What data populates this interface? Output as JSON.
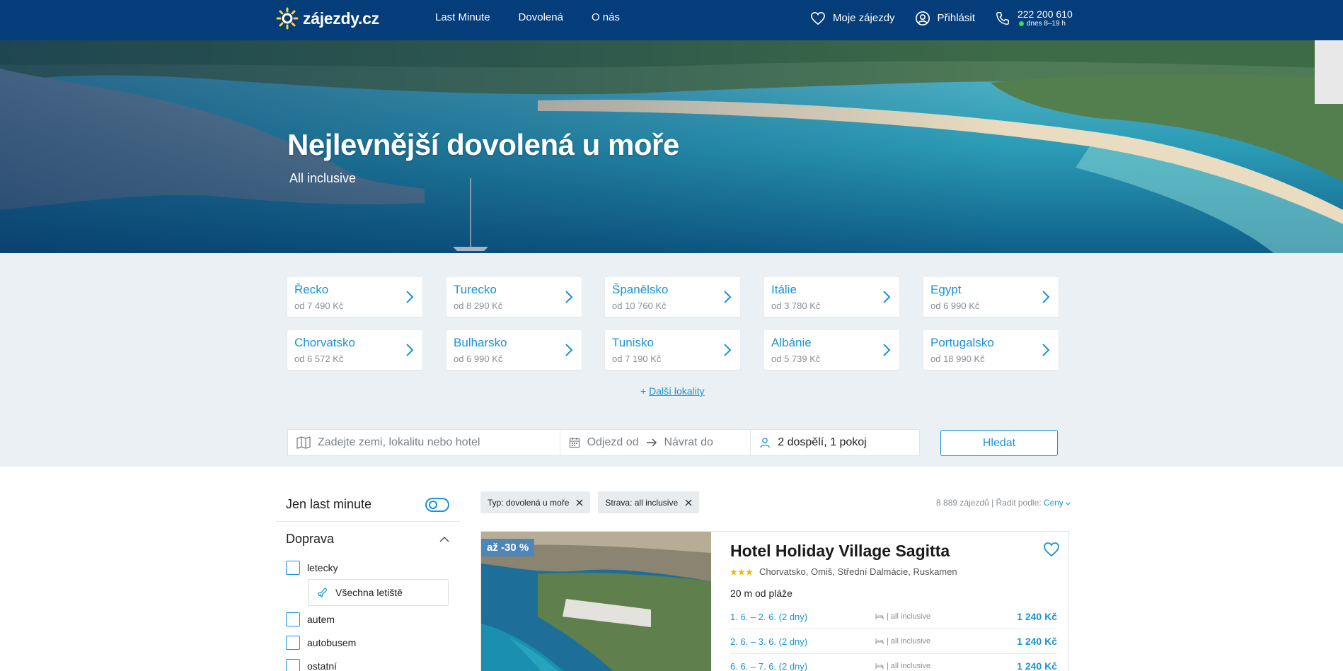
{
  "header": {
    "logo_text": "zájezdy.cz",
    "nav": [
      "Last Minute",
      "Dovolená",
      "O nás"
    ],
    "my_trips": "Moje zájezdy",
    "login": "Přihlásit",
    "phone": "222 200 610",
    "phone_hours": "dnes 8–19 h"
  },
  "hero": {
    "title": "Nejlevnější dovolená u moře",
    "subtitle": "All inclusive"
  },
  "destinations": [
    {
      "name": "Řecko",
      "price": "od 7 490 Kč"
    },
    {
      "name": "Turecko",
      "price": "od 8 290 Kč"
    },
    {
      "name": "Španělsko",
      "price": "od 10 760 Kč"
    },
    {
      "name": "Itálie",
      "price": "od 3 780 Kč"
    },
    {
      "name": "Egypt",
      "price": "od 6 990 Kč"
    },
    {
      "name": "Chorvatsko",
      "price": "od 6 572 Kč"
    },
    {
      "name": "Bulharsko",
      "price": "od 6 990 Kč"
    },
    {
      "name": "Tunisko",
      "price": "od 7 190 Kč"
    },
    {
      "name": "Albánie",
      "price": "od 5 739 Kč"
    },
    {
      "name": "Portugalsko",
      "price": "od 18 990 Kč"
    }
  ],
  "more_locations": {
    "prefix": "+ ",
    "label": "Další lokality"
  },
  "search": {
    "where_placeholder": "Zadejte zemi, lokalitu nebo hotel",
    "date_from": "Odjezd od",
    "date_to": "Návrat do",
    "persons": "2 dospělí, 1 pokoj",
    "button": "Hledat"
  },
  "filters": {
    "last_minute": "Jen last minute",
    "last_minute_on": false,
    "transport_title": "Doprava",
    "transport": [
      "letecky",
      "autem",
      "autobusem",
      "ostatní"
    ],
    "airports": "Všechna letiště"
  },
  "results": {
    "chips": [
      "Typ: dovolená u moře",
      "Strava: all inclusive"
    ],
    "count": "8 889 zájezdů",
    "sort_label": "Řadit podle:",
    "sort_value": "Ceny"
  },
  "hotel": {
    "discount": "až -30 %",
    "name": "Hotel Holiday Village Sagitta",
    "stars": 3,
    "location": "Chorvatsko, Omiš, Střední Dalmácie, Ruskamen",
    "beach": "20 m od pláže",
    "terms": [
      {
        "date": "1. 6. – 2. 6. (2 dny)",
        "board": "| all inclusive",
        "price": "1 240 Kč"
      },
      {
        "date": "2. 6. – 3. 6. (2 dny)",
        "board": "| all inclusive",
        "price": "1 240 Kč"
      },
      {
        "date": "6. 6. – 7. 6. (2 dny)",
        "board": "| all inclusive",
        "price": "1 240 Kč"
      }
    ]
  },
  "icons": {
    "logo": "sun-icon",
    "my_trips": "heart-icon",
    "login": "user-icon",
    "phone": "phone-icon",
    "dest": "chevron-right-icon",
    "where": "map-icon",
    "date": "calendar-icon",
    "persons": "person-icon",
    "airport": "plane-icon",
    "filter_collapse": "chevron-up-icon",
    "chip_remove": "close-icon",
    "board": "bed-icon",
    "favorite": "heart-icon"
  },
  "colors": {
    "header_bg": "#053c7a",
    "accent": "#1a93d6",
    "section_bg": "#ebf0f4",
    "online_dot": "#3ddc4a",
    "star": "#f5b800"
  }
}
